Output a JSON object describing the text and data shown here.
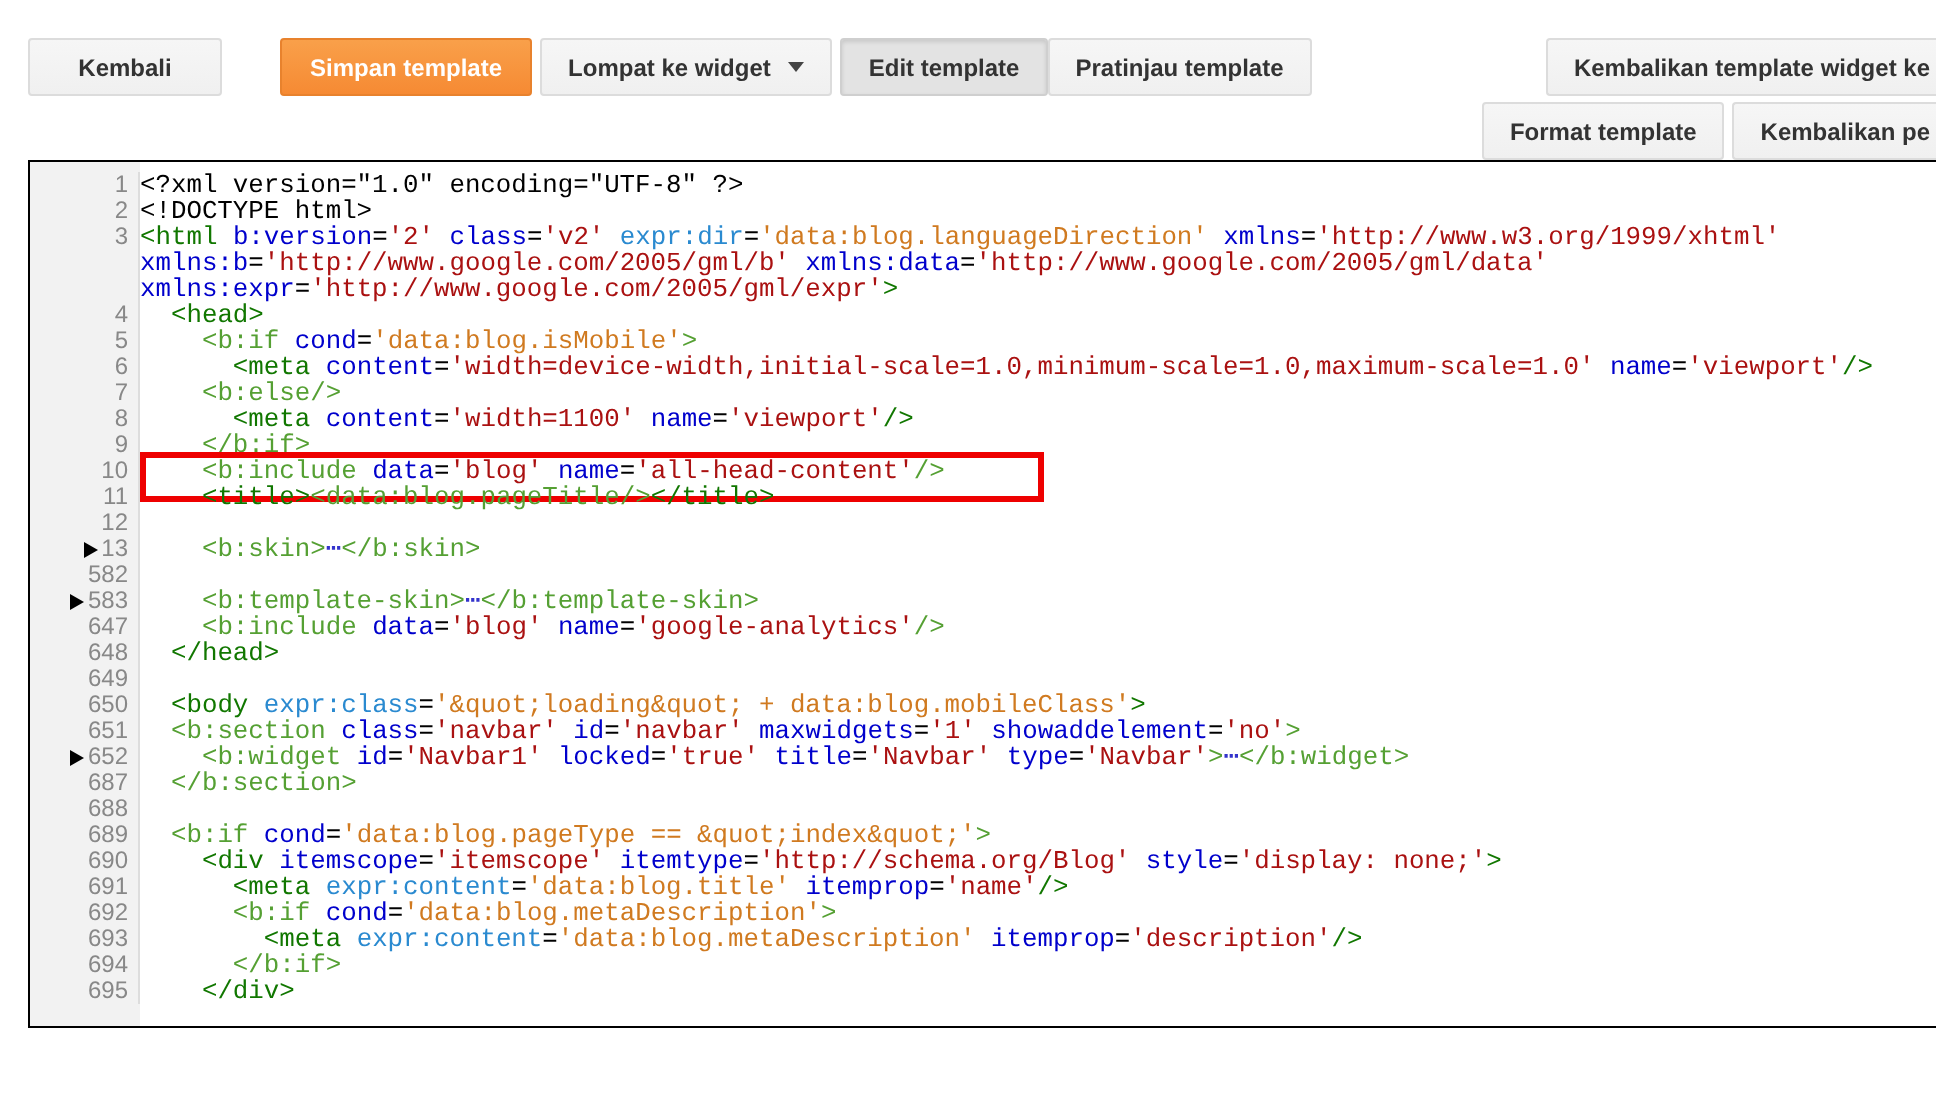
{
  "toolbar": {
    "left_buttons": [
      {
        "label": "Kembali",
        "kind": "plain"
      },
      {
        "label": "Simpan template",
        "kind": "primary"
      },
      {
        "label": "Lompat ke widget",
        "kind": "dropdown"
      }
    ],
    "view_tabs": [
      {
        "label": "Edit template",
        "selected": true
      },
      {
        "label": "Pratinjau template",
        "selected": false
      }
    ],
    "right_buttons": [
      {
        "label": "Kembalikan template widget ke"
      },
      {
        "label": "Format template"
      },
      {
        "label": "Kembalikan pe"
      }
    ]
  },
  "editor": {
    "lines": [
      {
        "number": "1",
        "collapsed": false,
        "highlighted": false,
        "text": "<?xml version=\"1.0\" encoding=\"UTF-8\" ?>"
      },
      {
        "number": "2",
        "collapsed": false,
        "highlighted": false,
        "text": "<!DOCTYPE html>"
      },
      {
        "number": "3",
        "collapsed": false,
        "highlighted": false,
        "text": "<html b:version='2' class='v2' expr:dir='data:blog.languageDirection' xmlns='http://www.w3.org/1999/xhtml' xmlns:b='http://www.google.com/2005/gml/b' xmlns:data='http://www.google.com/2005/gml/data' xmlns:expr='http://www.google.com/2005/gml/expr'>"
      },
      {
        "number": "4",
        "collapsed": false,
        "highlighted": false,
        "text": "  <head>"
      },
      {
        "number": "5",
        "collapsed": false,
        "highlighted": false,
        "text": "    <b:if cond='data:blog.isMobile'>"
      },
      {
        "number": "6",
        "collapsed": false,
        "highlighted": false,
        "text": "      <meta content='width=device-width,initial-scale=1.0,minimum-scale=1.0,maximum-scale=1.0' name='viewport'/>"
      },
      {
        "number": "7",
        "collapsed": false,
        "highlighted": false,
        "text": "    <b:else/>"
      },
      {
        "number": "8",
        "collapsed": false,
        "highlighted": false,
        "text": "      <meta content='width=1100' name='viewport'/>"
      },
      {
        "number": "9",
        "collapsed": false,
        "highlighted": false,
        "text": "    </b:if>"
      },
      {
        "number": "10",
        "collapsed": false,
        "highlighted": true,
        "text": "    <b:include data='blog' name='all-head-content'/>"
      },
      {
        "number": "11",
        "collapsed": false,
        "highlighted": false,
        "text": "    <title><data:blog.pageTitle/></title>"
      },
      {
        "number": "12",
        "collapsed": false,
        "highlighted": false
      },
      {
        "number": "13",
        "collapsed": true,
        "highlighted": false,
        "text": "    <b:skin>⋯</b:skin>"
      },
      {
        "number": "582",
        "collapsed": false,
        "highlighted": false
      },
      {
        "number": "583",
        "collapsed": true,
        "highlighted": false,
        "text": "    <b:template-skin>⋯</b:template-skin>"
      },
      {
        "number": "647",
        "collapsed": false,
        "highlighted": false,
        "text": "    <b:include data='blog' name='google-analytics'/>"
      },
      {
        "number": "648",
        "collapsed": false,
        "highlighted": false,
        "text": "  </head>"
      },
      {
        "number": "649",
        "collapsed": false,
        "highlighted": false
      },
      {
        "number": "650",
        "collapsed": false,
        "highlighted": false,
        "text": "  <body expr:class='&quot;loading&quot; + data:blog.mobileClass'>"
      },
      {
        "number": "651",
        "collapsed": false,
        "highlighted": false,
        "text": "  <b:section class='navbar' id='navbar' maxwidgets='1' showaddelement='no'>"
      },
      {
        "number": "652",
        "collapsed": true,
        "highlighted": false,
        "text": "    <b:widget id='Navbar1' locked='true' title='Navbar' type='Navbar'>⋯</b:widget>"
      },
      {
        "number": "687",
        "collapsed": false,
        "highlighted": false,
        "text": "  </b:section>"
      },
      {
        "number": "688",
        "collapsed": false,
        "highlighted": false
      },
      {
        "number": "689",
        "collapsed": false,
        "highlighted": false,
        "text": "  <b:if cond='data:blog.pageType == &quot;index&quot;'>"
      },
      {
        "number": "690",
        "collapsed": false,
        "highlighted": false,
        "text": "    <div itemscope='itemscope' itemtype='http://schema.org/Blog' style='display: none;'>"
      },
      {
        "number": "691",
        "collapsed": false,
        "highlighted": false,
        "text": "      <meta expr:content='data:blog.title' itemprop='name'/>"
      },
      {
        "number": "692",
        "collapsed": false,
        "highlighted": false,
        "text": "      <b:if cond='data:blog.metaDescription'>"
      },
      {
        "number": "693",
        "collapsed": false,
        "highlighted": false,
        "text": "        <meta expr:content='data:blog.metaDescription' itemprop='description'/>"
      },
      {
        "number": "694",
        "collapsed": false,
        "highlighted": false,
        "text": "      </b:if>"
      },
      {
        "number": "695",
        "collapsed": false,
        "highlighted": false,
        "text": "    </div>"
      }
    ]
  }
}
